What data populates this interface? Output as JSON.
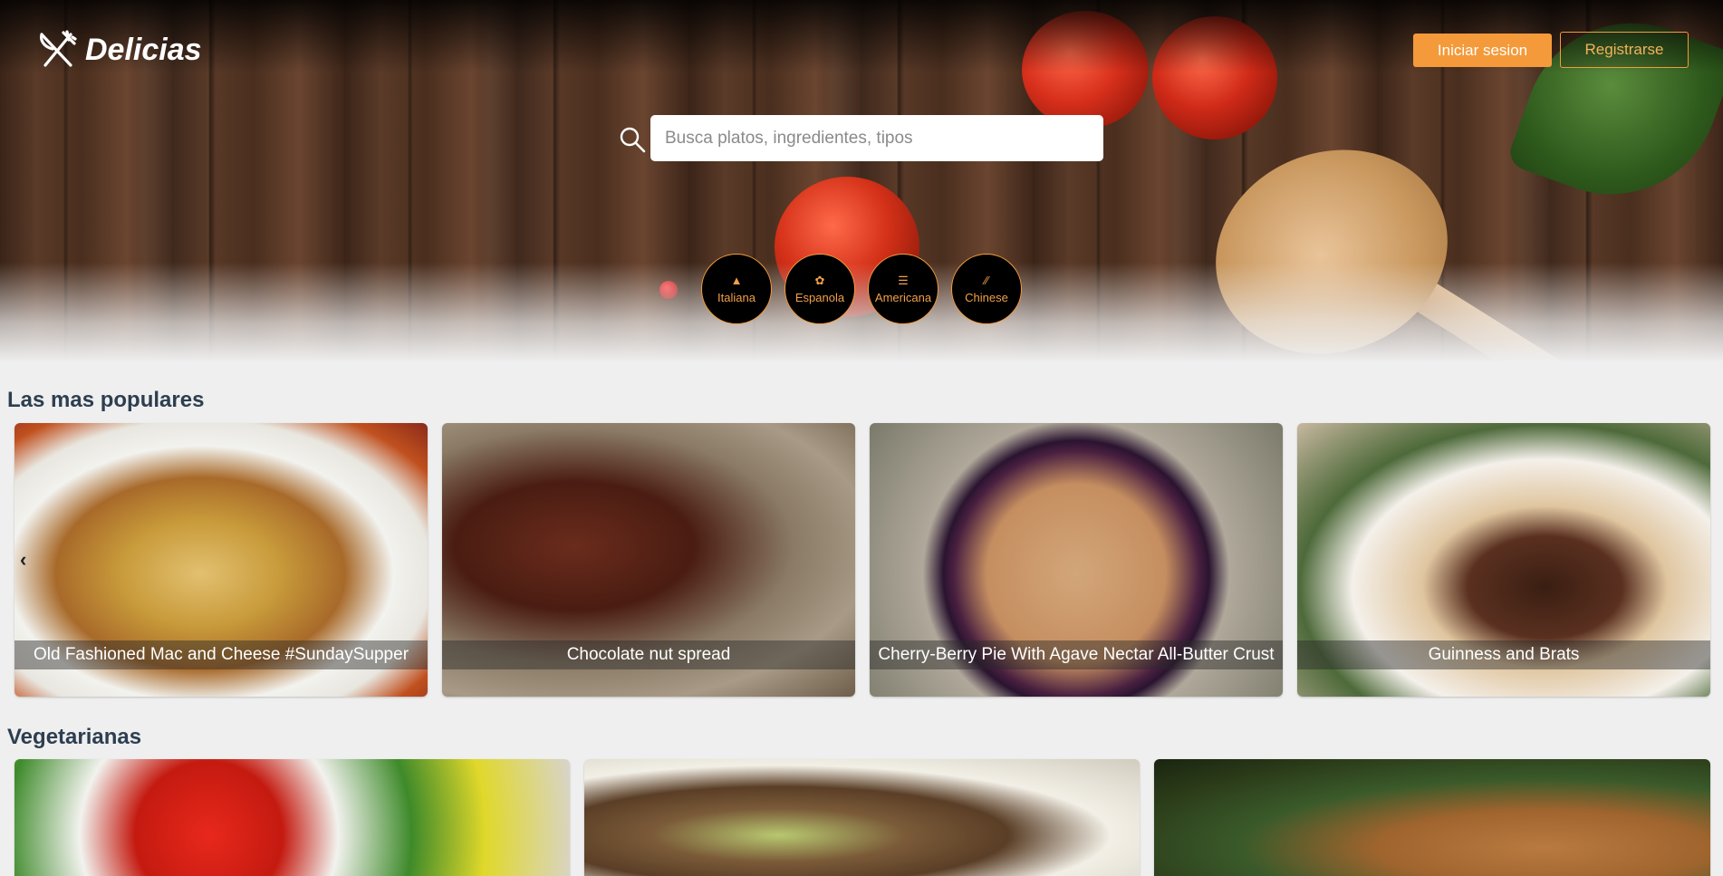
{
  "header": {
    "brand": "Delicias",
    "login_label": "Iniciar sesion",
    "register_label": "Registrarse"
  },
  "search": {
    "placeholder": "Busca platos, ingredientes, tipos",
    "value": ""
  },
  "categories": [
    {
      "label": "Italiana",
      "icon": "pizza-icon"
    },
    {
      "label": "Espanola",
      "icon": "chili-icon"
    },
    {
      "label": "Americana",
      "icon": "burger-icon"
    },
    {
      "label": "Chinese",
      "icon": "chopsticks-icon"
    }
  ],
  "popular": {
    "title": "Las mas populares",
    "cards": [
      {
        "title": "Old Fashioned Mac and Cheese #SundaySupper"
      },
      {
        "title": "Chocolate nut spread"
      },
      {
        "title": "Cherry-Berry Pie With Agave Nectar All-Butter Crust"
      },
      {
        "title": "Guinness and Brats"
      }
    ]
  },
  "vegetarian": {
    "title": "Vegetarianas",
    "cards": [
      {
        "title": ""
      },
      {
        "title": ""
      },
      {
        "title": ""
      }
    ]
  },
  "colors": {
    "accent": "#f49a3a",
    "heading": "#2d3e50",
    "background": "#efefef"
  }
}
